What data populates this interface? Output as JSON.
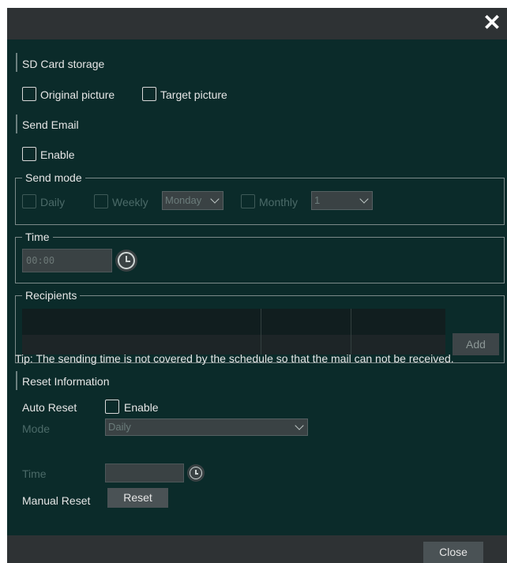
{
  "dialog": {
    "close_icon": "close-x-icon",
    "sections": {
      "sd_card": {
        "title": "SD Card storage",
        "original_picture": "Original picture",
        "target_picture": "Target picture"
      },
      "send_email": {
        "title": "Send Email",
        "enable": "Enable"
      }
    },
    "send_mode": {
      "legend": "Send mode",
      "daily": "Daily",
      "weekly": "Weekly",
      "weekday_value": "Monday",
      "monthly": "Monthly",
      "day_value": "1"
    },
    "time": {
      "legend": "Time",
      "value": "00:00",
      "clock_icon": "clock-icon"
    },
    "recipients": {
      "legend": "Recipients",
      "add_label": "Add"
    },
    "tip": "Tip: The sending time is not covered by the schedule so that the mail can not be received.",
    "reset": {
      "title": "Reset Information",
      "auto_reset_label": "Auto Reset",
      "enable": "Enable",
      "mode_label": "Mode",
      "mode_value": "Daily",
      "time_label": "Time",
      "time_value": "",
      "manual_reset_label": "Manual Reset",
      "reset_button": "Reset"
    },
    "footer": {
      "close_label": "Close"
    },
    "colors": {
      "background": "#0b2b2a",
      "titlebar": "#2e3234",
      "text": "#e6e6e6",
      "disabled_text": "#4b6a68"
    }
  }
}
